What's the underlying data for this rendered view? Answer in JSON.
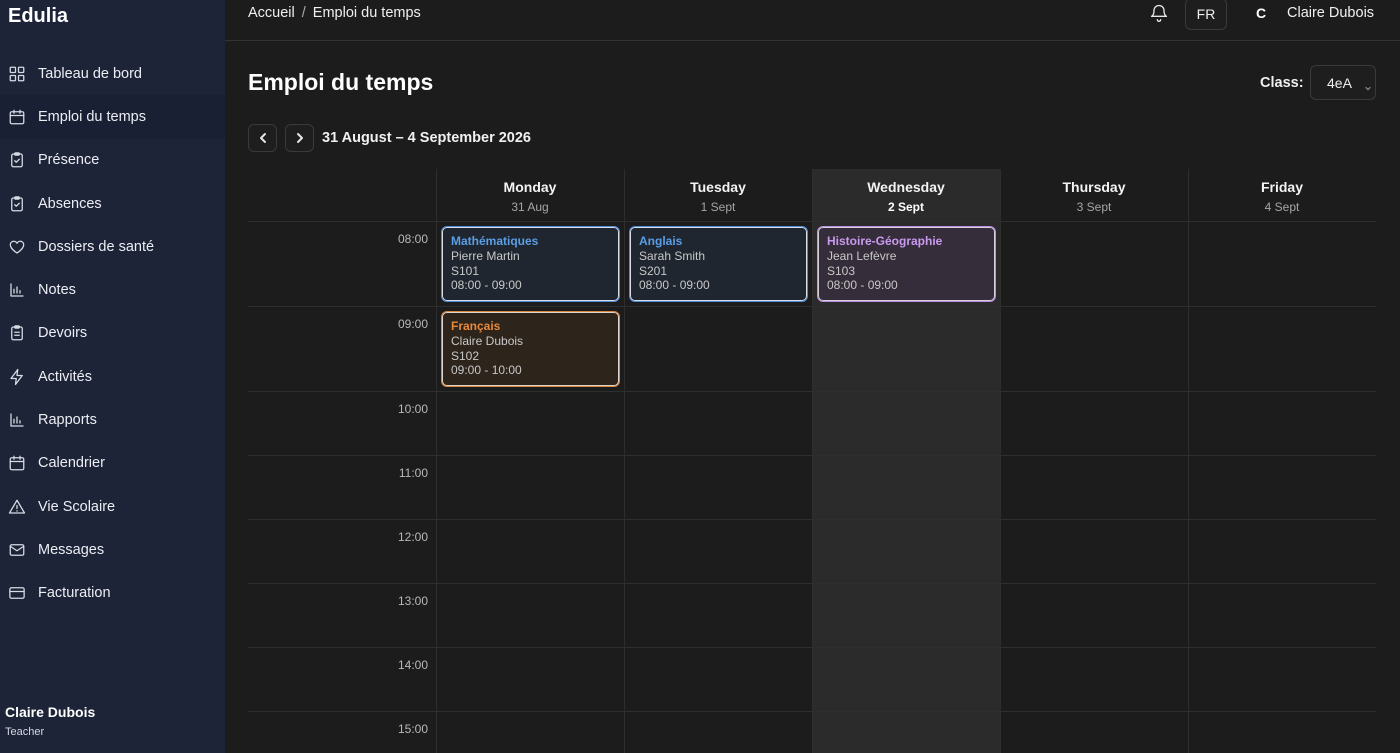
{
  "brand": "Edulia",
  "sidebar": {
    "items": [
      {
        "label": "Tableau de bord",
        "icon": "grid-icon"
      },
      {
        "label": "Emploi du temps",
        "icon": "calendar-icon",
        "active": true
      },
      {
        "label": "Présence",
        "icon": "clipboard-check-icon"
      },
      {
        "label": "Absences",
        "icon": "clipboard-check-icon"
      },
      {
        "label": "Dossiers de santé",
        "icon": "heart-icon"
      },
      {
        "label": "Notes",
        "icon": "bar-chart-icon"
      },
      {
        "label": "Devoirs",
        "icon": "clipboard-list-icon"
      },
      {
        "label": "Activités",
        "icon": "bolt-icon"
      },
      {
        "label": "Rapports",
        "icon": "bar-chart-icon"
      },
      {
        "label": "Calendrier",
        "icon": "calendar-icon"
      },
      {
        "label": "Vie Scolaire",
        "icon": "warning-icon"
      },
      {
        "label": "Messages",
        "icon": "mail-icon"
      },
      {
        "label": "Facturation",
        "icon": "credit-card-icon"
      }
    ],
    "user": {
      "name": "Claire Dubois",
      "role": "Teacher"
    }
  },
  "header": {
    "breadcrumb": [
      "Accueil",
      "Emploi du temps"
    ],
    "lang": "FR",
    "avatar_initial": "C",
    "user_name": "Claire Dubois"
  },
  "main": {
    "title": "Emploi du temps",
    "class_label": "Class:",
    "class_value": "4eA",
    "range": "31 August – 4 September 2026"
  },
  "calendar": {
    "days": [
      {
        "name": "Monday",
        "date": "31 Aug"
      },
      {
        "name": "Tuesday",
        "date": "1 Sept"
      },
      {
        "name": "Wednesday",
        "date": "2 Sept",
        "today": true
      },
      {
        "name": "Thursday",
        "date": "3 Sept"
      },
      {
        "name": "Friday",
        "date": "4 Sept"
      }
    ],
    "times": [
      "08:00",
      "09:00",
      "10:00",
      "11:00",
      "12:00",
      "13:00",
      "14:00",
      "15:00"
    ],
    "events": [
      {
        "day": 0,
        "slot": 0,
        "title": "Mathématiques",
        "teacher": "Pierre Martin",
        "room": "S101",
        "time": "08:00 - 09:00",
        "color": "blue"
      },
      {
        "day": 1,
        "slot": 0,
        "title": "Anglais",
        "teacher": "Sarah Smith",
        "room": "S201",
        "time": "08:00 - 09:00",
        "color": "blue"
      },
      {
        "day": 2,
        "slot": 0,
        "title": "Histoire-Géographie",
        "teacher": "Jean Lefèvre",
        "room": "S103",
        "time": "08:00 - 09:00",
        "color": "purple"
      },
      {
        "day": 0,
        "slot": 1,
        "title": "Français",
        "teacher": "Claire Dubois",
        "room": "S102",
        "time": "09:00 - 10:00",
        "color": "orange"
      }
    ]
  }
}
